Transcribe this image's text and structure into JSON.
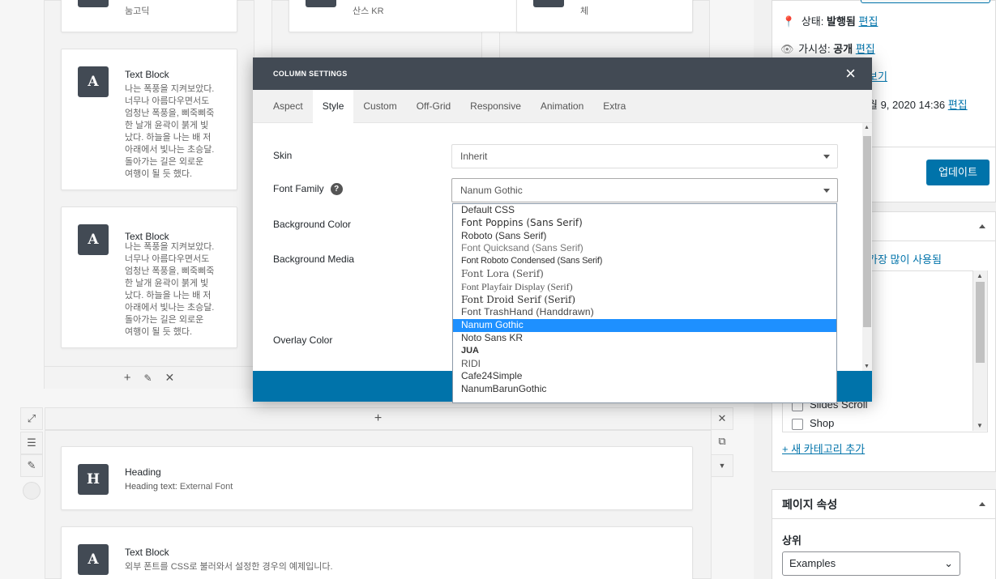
{
  "builder": {
    "top_cards": [
      {
        "text": "눔고딕"
      },
      {
        "text": "산스 KR"
      },
      {
        "text": "체"
      }
    ],
    "text_blocks": [
      {
        "title": "Text Block",
        "text": "나는 폭풍을 지켜보았다.\n너무나 아름다우면서도\n엄청난 폭풍을, 삐죽삐죽\n한 날개 윤곽이 붉게 빛\n났다. 하늘을 나는 배 저\n아래에서 빛나는 초승달.\n돌아가는 길은 외로운\n여행이 될 듯 했다."
      },
      {
        "title": "Text Block",
        "text": "나는 폭풍을 지켜보았다.\n너무나 아름다우면서도\n엄청난 폭풍을, 삐죽삐죽\n한 날개 윤곽이 붉게 빛\n났다. 하늘을 나는 배 저\n아래에서 빛나는 초승달.\n돌아가는 길은 외로운\n여행이 될 듯 했다."
      }
    ],
    "heading_card": {
      "title": "Heading",
      "label": "Heading text:",
      "value": "External Font"
    },
    "bottom_text_card": {
      "title": "Text Block",
      "text": "외부 폰트를 CSS로 불러와서 설정한 경우의 예제입니다."
    },
    "icons": {
      "text_block": "A",
      "heading": "H"
    }
  },
  "modal": {
    "title": "COLUMN SETTINGS",
    "close": "×",
    "tabs": [
      "Aspect",
      "Style",
      "Custom",
      "Off-Grid",
      "Responsive",
      "Animation",
      "Extra"
    ],
    "active_tab": "Style",
    "fields": {
      "skin_label": "Skin",
      "skin_value": "Inherit",
      "font_label": "Font Family",
      "font_help": "?",
      "font_value": "Nanum Gothic",
      "bg_color_label": "Background Color",
      "bg_media_label": "Background Media",
      "overlay_label": "Overlay Color"
    },
    "font_options": [
      "Default CSS",
      "Font Poppins (Sans Serif)",
      "Roboto (Sans Serif)",
      "Font Quicksand (Sans Serif)",
      "Font Roboto Condensed (Sans Serif)",
      "Font Lora (Serif)",
      "Font Playfair Display (Serif)",
      "Font Droid Serif (Serif)",
      "Font TrashHand (Handdrawn)",
      "Nanum Gothic",
      "Noto Sans KR",
      "JUA",
      "RIDI",
      "Cafe24Simple",
      "NanumBarunGothic"
    ],
    "selected_font_index": 9
  },
  "sidebar": {
    "status_label": "상태:",
    "status_value": "발행됨",
    "visibility_label": "가시성:",
    "visibility_value": "공개",
    "edit": "편집",
    "preview_fragment": "보기",
    "date_fragment": "월 9, 2020 14:36",
    "update_button": "업데이트",
    "most_used": "가장 많이 사용됨",
    "categories": [
      "Slides Scroll",
      "Shop"
    ],
    "add_category": "+ 새 카테고리 추가",
    "page_attrs_title": "페이지 속성",
    "parent_label": "상위",
    "parent_value": "Examples"
  }
}
